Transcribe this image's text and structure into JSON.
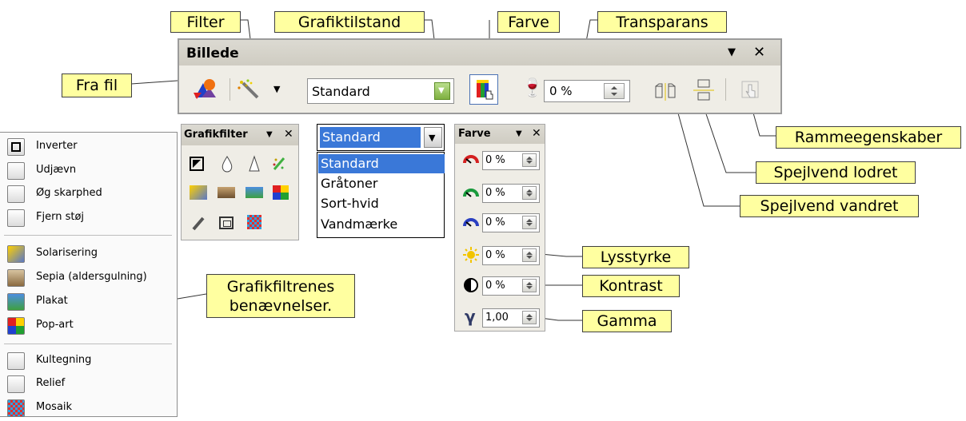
{
  "callouts": {
    "filter": "Filter",
    "grafiktilstand": "Grafiktilstand",
    "farve": "Farve",
    "transparans": "Transparans",
    "fra_fil": "Fra fil",
    "rammeegenskaber": "Rammeegenskaber",
    "spejlvend_lodret": "Spejlvend lodret",
    "spejlvend_vandret": "Spejlvend vandret",
    "grafikfiltrenes_line1": "Grafikfiltrenes",
    "grafikfiltrenes_line2": "benævnelser.",
    "lysstyrke": "Lysstyrke",
    "kontrast": "Kontrast",
    "gamma": "Gamma"
  },
  "toolbar": {
    "title": "Billede",
    "mode_value": "Standard",
    "transparency_value": "0 %",
    "menu_arrow": "▼",
    "close": "✕"
  },
  "filter_panel": {
    "title": "Grafikfilter",
    "menu_arrow": "▼",
    "close": "✕"
  },
  "mode_dropdown": {
    "selected": "Standard",
    "options": [
      "Standard",
      "Gråtoner",
      "Sort-hvid",
      "Vandmærke"
    ]
  },
  "color_panel": {
    "title": "Farve",
    "menu_arrow": "▼",
    "close": "✕",
    "rows": [
      {
        "name": "red",
        "value": "0 %",
        "color": "#d42020"
      },
      {
        "name": "green",
        "value": "0 %",
        "color": "#1a9a3c"
      },
      {
        "name": "blue",
        "value": "0 %",
        "color": "#2a3fc0"
      },
      {
        "name": "brightness",
        "value": "0 %",
        "color": "#f2c400"
      },
      {
        "name": "contrast",
        "value": "0 %",
        "color": "#000000"
      },
      {
        "name": "gamma",
        "value": "1,00",
        "color": "#303a66",
        "symbol": "γ"
      }
    ]
  },
  "filter_menu": {
    "items": [
      {
        "label": "Inverter",
        "icon": "invert-icon"
      },
      {
        "label": "Udjævn",
        "icon": "smooth-icon"
      },
      {
        "label": "Øg skarphed",
        "icon": "sharpen-icon"
      },
      {
        "label": "Fjern støj",
        "icon": "remove-noise-icon"
      },
      {
        "label": "Solarisering",
        "icon": "solarize-icon"
      },
      {
        "label": "Sepia (aldersgulning)",
        "icon": "sepia-icon"
      },
      {
        "label": "Plakat",
        "icon": "poster-icon"
      },
      {
        "label": "Pop-art",
        "icon": "pop-art-icon"
      },
      {
        "label": "Kultegning",
        "icon": "charcoal-icon"
      },
      {
        "label": "Relief",
        "icon": "relief-icon"
      },
      {
        "label": "Mosaik",
        "icon": "mosaic-icon"
      }
    ]
  }
}
